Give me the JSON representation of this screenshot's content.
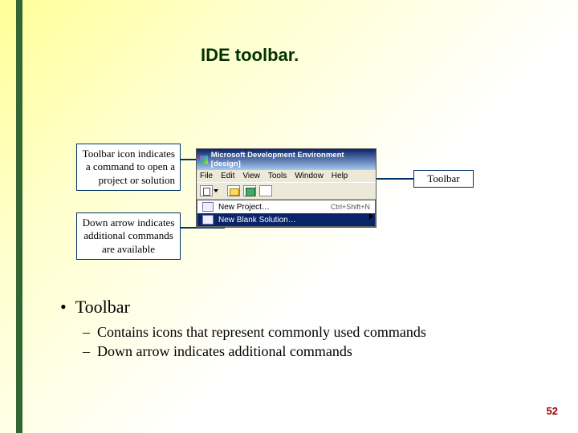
{
  "title": "IDE toolbar.",
  "callout1": "Toolbar icon indicates a command to open a project or solution",
  "callout2": "Down arrow indicates additional commands are available",
  "callout3": "Toolbar",
  "ide": {
    "window_title": "Microsoft Development Environment [design]",
    "menu": {
      "file": "File",
      "edit": "Edit",
      "view": "View",
      "tools": "Tools",
      "window": "Window",
      "help": "Help"
    },
    "dropdown": {
      "item1": "New Project…",
      "shortcut1": "Ctrl+Shift+N",
      "item2": "New Blank Solution…"
    }
  },
  "bullets": {
    "main": "Toolbar",
    "sub1": "Contains icons that represent commonly used commands",
    "sub2": "Down arrow indicates additional commands"
  },
  "page": "52"
}
